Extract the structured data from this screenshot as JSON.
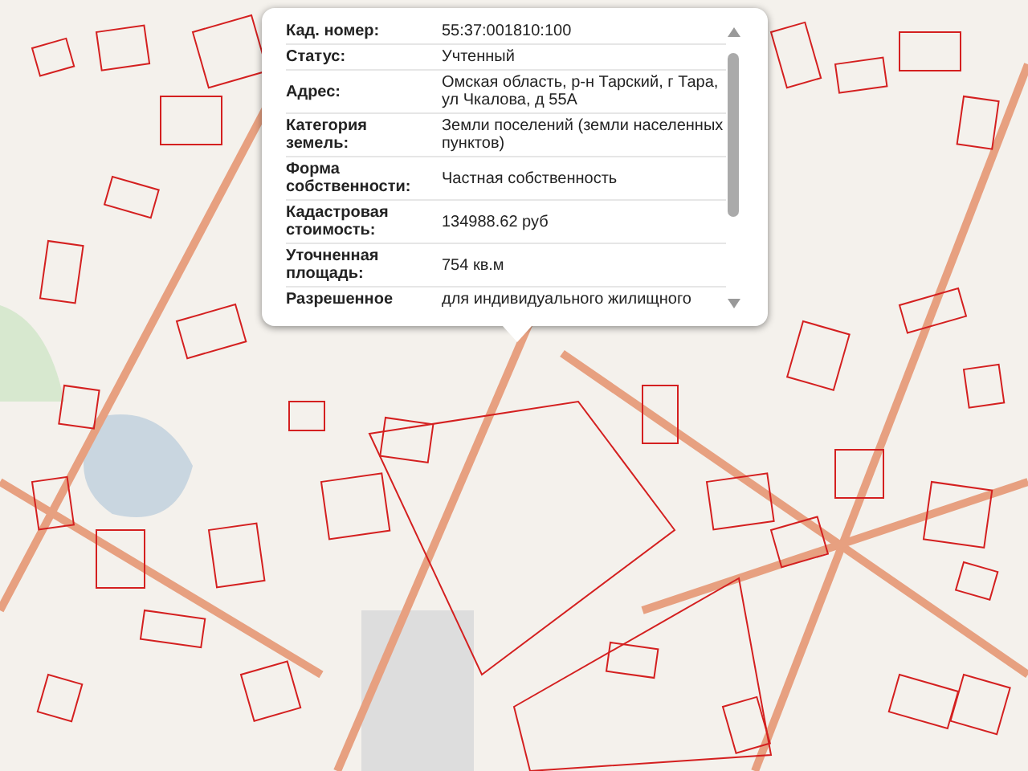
{
  "popup": {
    "rows": [
      {
        "label": "Кад. номер:",
        "value": "55:37:001810:100"
      },
      {
        "label": "Статус:",
        "value": "Учтенный"
      },
      {
        "label": "Адрес:",
        "value": "Омская область, р-н Тарский, г Тара, ул Чкалова, д 55А"
      },
      {
        "label": "Категория земель:",
        "value": "Земли поселений (земли населенных пунктов)"
      },
      {
        "label": "Форма собственности:",
        "value": "Частная собственность"
      },
      {
        "label": "Кадастровая стоимость:",
        "value": "134988.62 руб"
      },
      {
        "label": "Уточненная площадь:",
        "value": "754 кв.м"
      },
      {
        "label": "Разрешенное",
        "value": "для индивидуального жилищного"
      }
    ]
  }
}
